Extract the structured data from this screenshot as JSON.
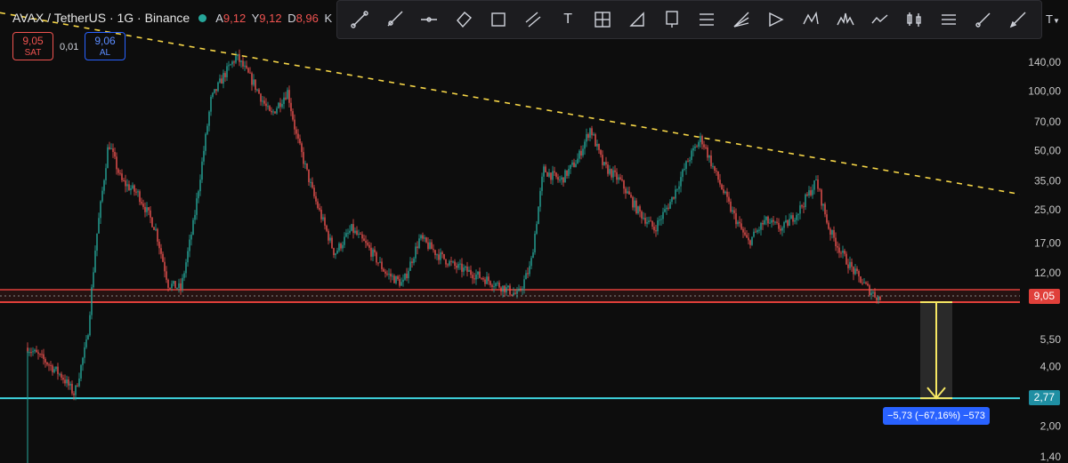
{
  "header": {
    "symbol": "AVAX / TetherUS · 1G · Binance",
    "ohlc": [
      {
        "key": "A",
        "value": "9,12"
      },
      {
        "key": "Y",
        "value": "9,12"
      },
      {
        "key": "D",
        "value": "8,96"
      }
    ],
    "trailing": "K"
  },
  "trade_buttons": {
    "sell_price": "9,05",
    "sell_label": "SAT",
    "buy_price": "9,06",
    "buy_label": "AL",
    "spread": "0,01"
  },
  "toolbar": {
    "tools": [
      "trend-line",
      "ray",
      "horizontal-ray",
      "rotated-rectangle",
      "rectangle",
      "parallel-channel",
      "text",
      "grid",
      "arc",
      "price-label",
      "fib-retracement",
      "fib-fan",
      "triangle-pattern",
      "xabcd-pattern",
      "head-shoulders",
      "path",
      "candles-pattern",
      "multi-line",
      "brush",
      "pen"
    ],
    "text_tool_label": "T",
    "more_label": "T"
  },
  "chart_data": {
    "type": "candlestick",
    "y_scale": "log",
    "ylim": [
      1.3,
      290
    ],
    "y_ticks": [
      {
        "value": 140,
        "label": "140,00"
      },
      {
        "value": 100,
        "label": "100,00"
      },
      {
        "value": 70,
        "label": "70,00"
      },
      {
        "value": 50,
        "label": "50,00"
      },
      {
        "value": 35,
        "label": "35,00"
      },
      {
        "value": 25,
        "label": "25,00"
      },
      {
        "value": 17,
        "label": "17,00"
      },
      {
        "value": 12,
        "label": "12,00"
      },
      {
        "value": 5.5,
        "label": "5,50"
      },
      {
        "value": 4,
        "label": "4,00"
      },
      {
        "value": 2,
        "label": "2,00"
      },
      {
        "value": 1.4,
        "label": "1,40"
      }
    ],
    "price_path": [
      [
        0.0,
        5.0
      ],
      [
        0.02,
        4.3
      ],
      [
        0.04,
        3.6
      ],
      [
        0.055,
        2.9
      ],
      [
        0.07,
        5.5
      ],
      [
        0.08,
        17
      ],
      [
        0.095,
        55
      ],
      [
        0.11,
        35
      ],
      [
        0.13,
        30
      ],
      [
        0.15,
        20
      ],
      [
        0.165,
        10.5
      ],
      [
        0.18,
        10
      ],
      [
        0.195,
        22
      ],
      [
        0.215,
        90
      ],
      [
        0.23,
        120
      ],
      [
        0.245,
        150
      ],
      [
        0.265,
        110
      ],
      [
        0.285,
        75
      ],
      [
        0.305,
        100
      ],
      [
        0.315,
        60
      ],
      [
        0.335,
        30
      ],
      [
        0.36,
        15
      ],
      [
        0.38,
        20
      ],
      [
        0.4,
        16
      ],
      [
        0.42,
        12
      ],
      [
        0.44,
        10.5
      ],
      [
        0.46,
        18
      ],
      [
        0.48,
        15
      ],
      [
        0.5,
        13
      ],
      [
        0.52,
        12
      ],
      [
        0.54,
        11
      ],
      [
        0.56,
        10
      ],
      [
        0.575,
        9.2
      ],
      [
        0.59,
        13
      ],
      [
        0.605,
        40
      ],
      [
        0.625,
        35
      ],
      [
        0.645,
        45
      ],
      [
        0.66,
        65
      ],
      [
        0.675,
        42
      ],
      [
        0.695,
        35
      ],
      [
        0.715,
        25
      ],
      [
        0.735,
        20
      ],
      [
        0.755,
        28
      ],
      [
        0.775,
        45
      ],
      [
        0.79,
        58
      ],
      [
        0.805,
        40
      ],
      [
        0.825,
        25
      ],
      [
        0.845,
        17
      ],
      [
        0.865,
        22
      ],
      [
        0.885,
        20
      ],
      [
        0.905,
        25
      ],
      [
        0.925,
        35
      ],
      [
        0.94,
        20
      ],
      [
        0.955,
        15
      ],
      [
        0.97,
        12
      ],
      [
        0.985,
        10
      ],
      [
        1.0,
        8.8
      ]
    ],
    "last_price": 9.05,
    "support_price": 2.77,
    "measure": {
      "from": 9.05,
      "to": 2.77,
      "label": "−5,73 (−67,16%) −573"
    }
  },
  "price_badges": {
    "current": "9,05",
    "support": "2,77"
  },
  "colors": {
    "up": "#26a69a",
    "down": "#ef5350",
    "trendline": "#f5d547",
    "support_line": "#3fd5e0",
    "resistance_band": "#e0403a",
    "measure_arrow": "#f5e663"
  }
}
